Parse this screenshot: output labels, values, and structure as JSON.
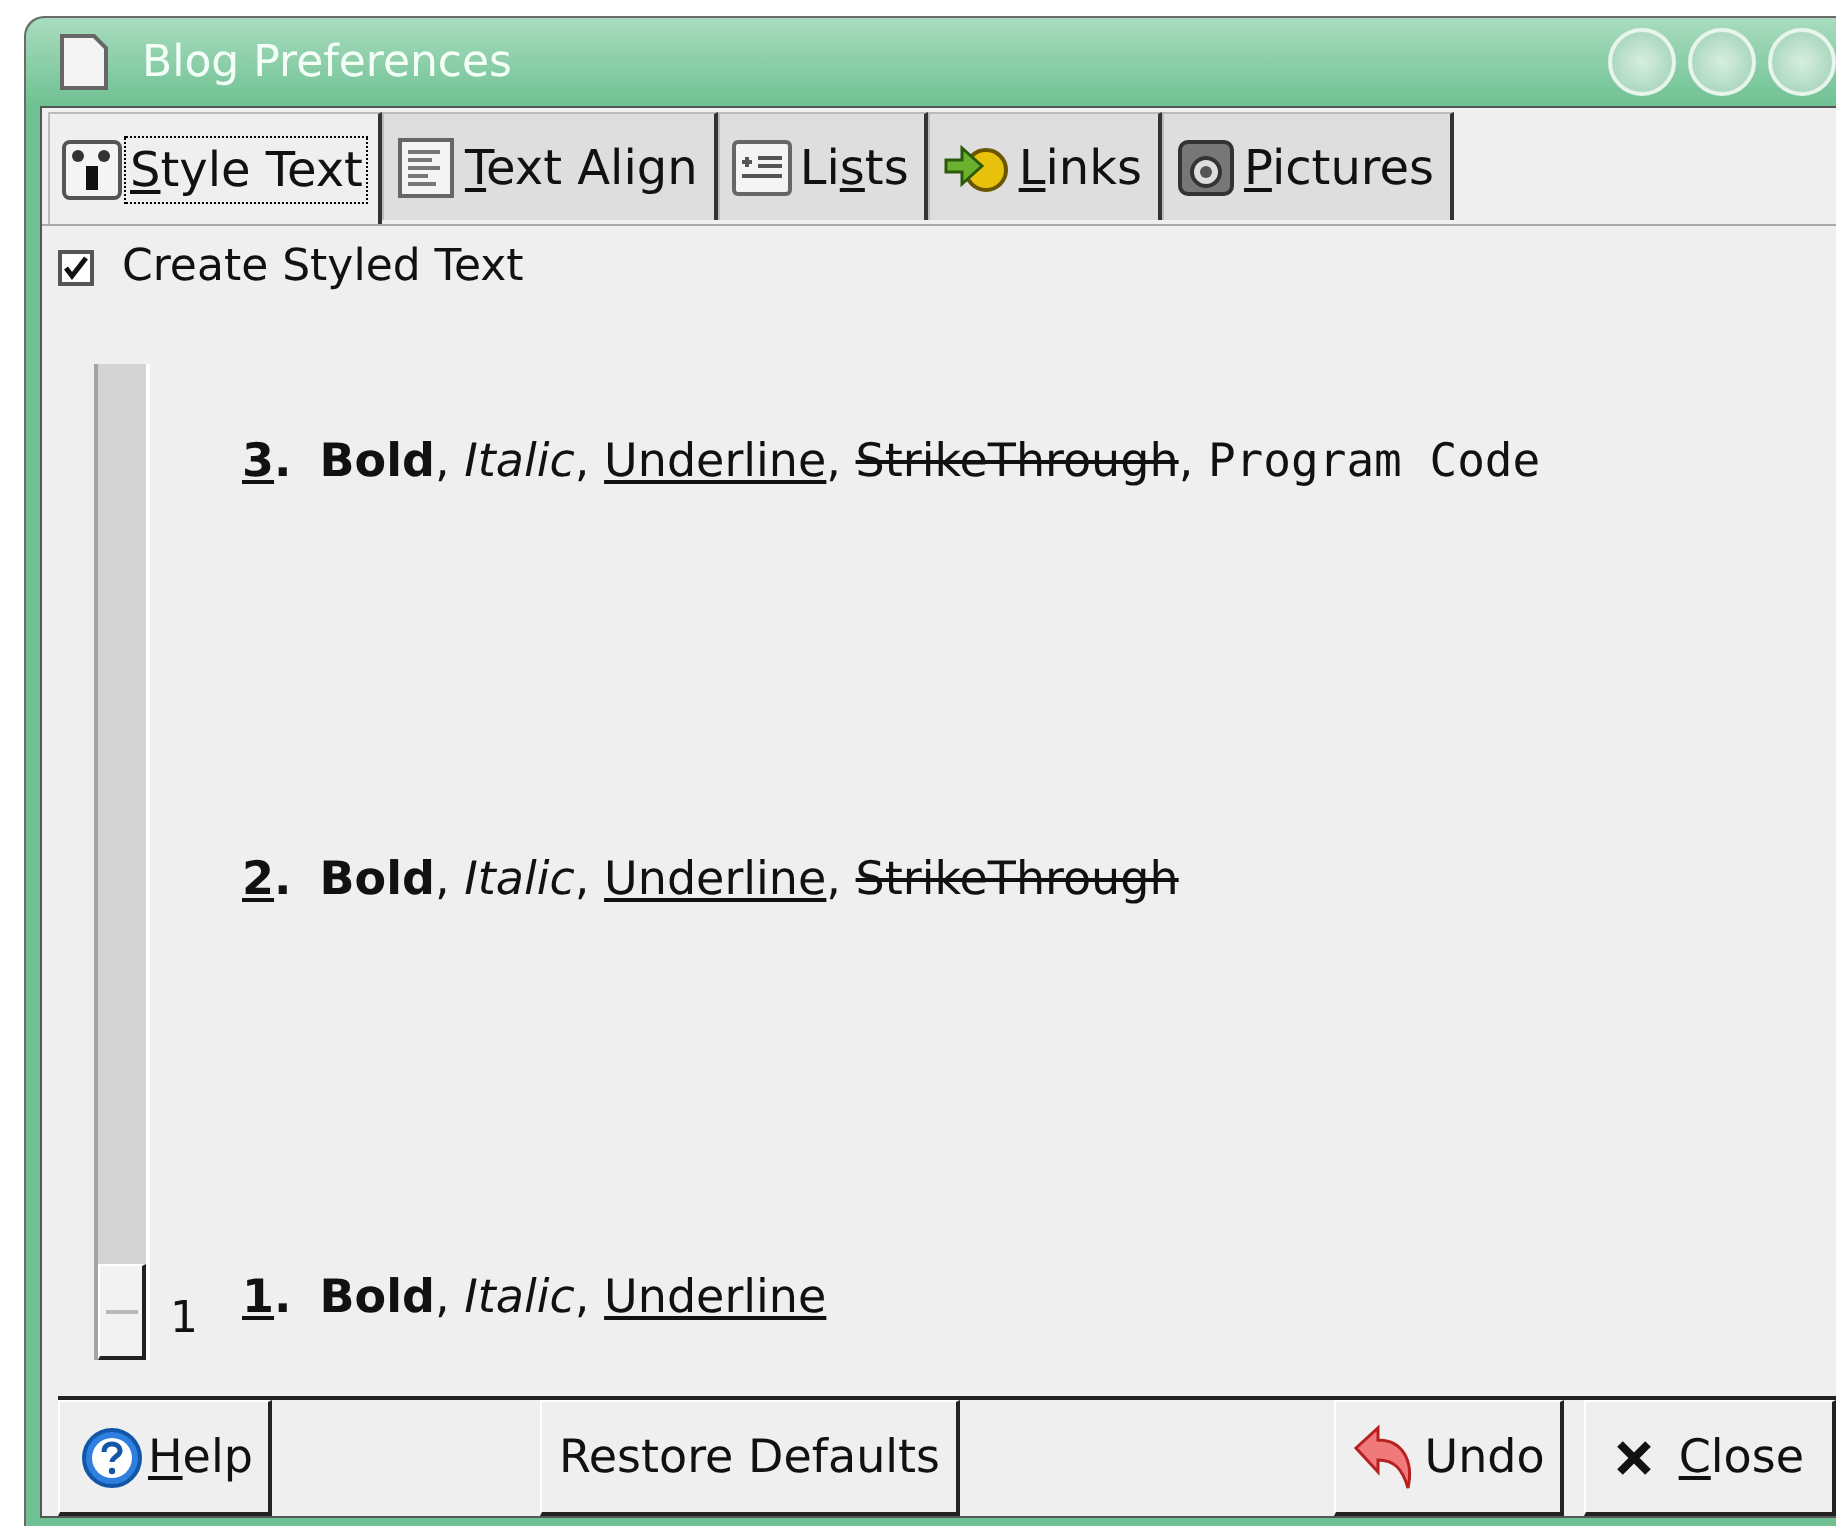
{
  "window": {
    "title": "Blog Preferences"
  },
  "tabs": [
    {
      "kind": "style",
      "key": "S",
      "after": "tyle Text",
      "selected": true
    },
    {
      "kind": "align",
      "key": "T",
      "after": "ext Align",
      "selected": false
    },
    {
      "kind": "lists",
      "before": "Li",
      "key": "s",
      "after": "ts",
      "selected": false
    },
    {
      "kind": "links",
      "key": "L",
      "after": "inks",
      "selected": false
    },
    {
      "kind": "pictures",
      "key": "P",
      "after": "ictures",
      "selected": false
    }
  ],
  "styled_text": {
    "label": "Create Styled Text",
    "checked": true
  },
  "slider": {
    "reading": "1"
  },
  "items": [
    {
      "number": "3",
      "dot": ".",
      "segments": [
        {
          "kind": "bold",
          "text": "Bold",
          "after": ", "
        },
        {
          "kind": "italic",
          "text": "Italic",
          "after": ", "
        },
        {
          "kind": "underline",
          "text": "Underline",
          "after": ", "
        },
        {
          "kind": "strike",
          "text": "StrikeThrough",
          "after": ", "
        },
        {
          "kind": "code",
          "text": "Program Code"
        }
      ]
    },
    {
      "number": "2",
      "dot": ".",
      "segments": [
        {
          "kind": "bold",
          "text": "Bold",
          "after": ", "
        },
        {
          "kind": "italic",
          "text": "Italic",
          "after": ", "
        },
        {
          "kind": "underline",
          "text": "Underline",
          "after": ", "
        },
        {
          "kind": "strike",
          "text": "StrikeThrough"
        }
      ]
    },
    {
      "number": "1",
      "dot": ".",
      "segments": [
        {
          "kind": "bold",
          "text": "Bold",
          "after": ", "
        },
        {
          "kind": "italic",
          "text": "Italic",
          "after": ", "
        },
        {
          "kind": "underline",
          "text": "Underline"
        }
      ]
    }
  ],
  "buttons": [
    {
      "kind": "help",
      "key": "H",
      "after": "elp"
    },
    {
      "kind": "restore",
      "after": "Restore Defaults"
    },
    {
      "kind": "undo",
      "after": "Undo"
    },
    {
      "kind": "close",
      "key": "C",
      "after": "lose"
    }
  ]
}
